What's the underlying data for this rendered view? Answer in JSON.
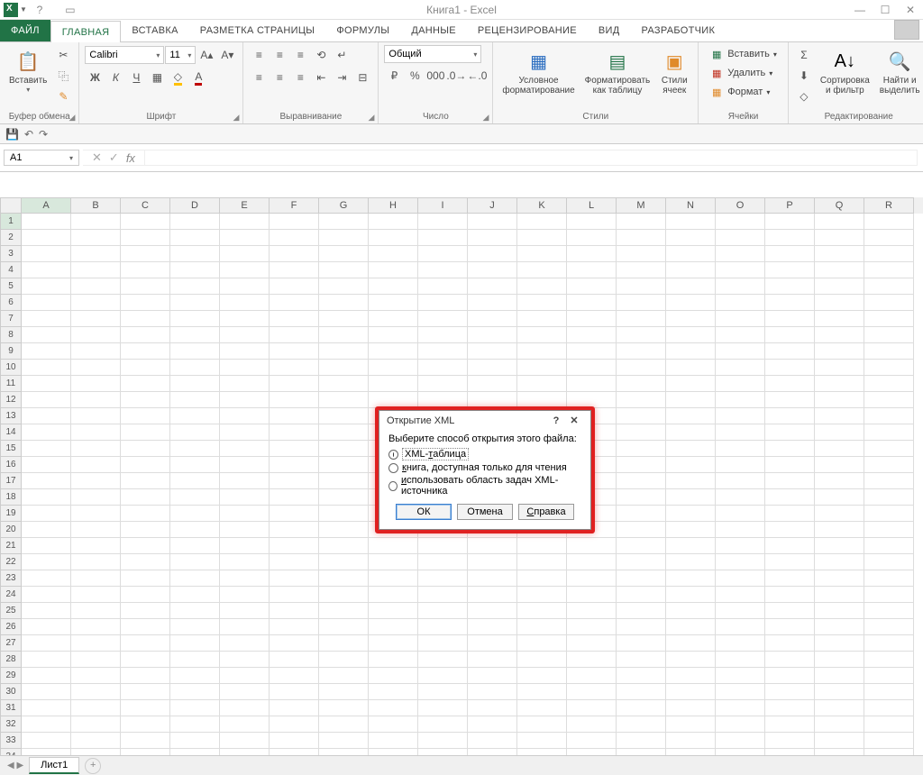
{
  "title": "Книга1 - Excel",
  "tabs": {
    "file": "ФАЙЛ",
    "home": "ГЛАВНАЯ",
    "insert": "ВСТАВКА",
    "pagelayout": "РАЗМЕТКА СТРАНИЦЫ",
    "formulas": "ФОРМУЛЫ",
    "data": "ДАННЫЕ",
    "review": "РЕЦЕНЗИРОВАНИЕ",
    "view": "ВИД",
    "developer": "РАЗРАБОТЧИК"
  },
  "ribbon": {
    "clipboard": {
      "label": "Буфер обмена",
      "paste": "Вставить"
    },
    "font": {
      "label": "Шрифт",
      "name": "Calibri",
      "size": "11"
    },
    "alignment": {
      "label": "Выравнивание"
    },
    "number": {
      "label": "Число",
      "format": "Общий"
    },
    "styles": {
      "label": "Стили",
      "cond": "Условное форматирование",
      "table": "Форматировать как таблицу",
      "cell": "Стили ячеек"
    },
    "cells": {
      "label": "Ячейки",
      "insert": "Вставить",
      "delete": "Удалить",
      "format": "Формат"
    },
    "editing": {
      "label": "Редактирование",
      "sort": "Сортировка и фильтр",
      "find": "Найти и выделить"
    }
  },
  "namebox": "A1",
  "columns": [
    "A",
    "B",
    "C",
    "D",
    "E",
    "F",
    "G",
    "H",
    "I",
    "J",
    "K",
    "L",
    "M",
    "N",
    "O",
    "P",
    "Q",
    "R"
  ],
  "rowcount": 34,
  "sheet": {
    "name": "Лист1"
  },
  "dialog": {
    "title": "Открытие XML",
    "prompt": "Выберите способ открытия этого файла:",
    "opt1": "XML-таблица",
    "opt1_ul": "т",
    "opt2_pre": "к",
    "opt2": "нига, доступная только для чтения",
    "opt3_pre": "и",
    "opt3": "спользовать область задач XML-источника",
    "ok": "ОК",
    "cancel": "Отмена",
    "help_ul": "С",
    "help": "правка"
  }
}
